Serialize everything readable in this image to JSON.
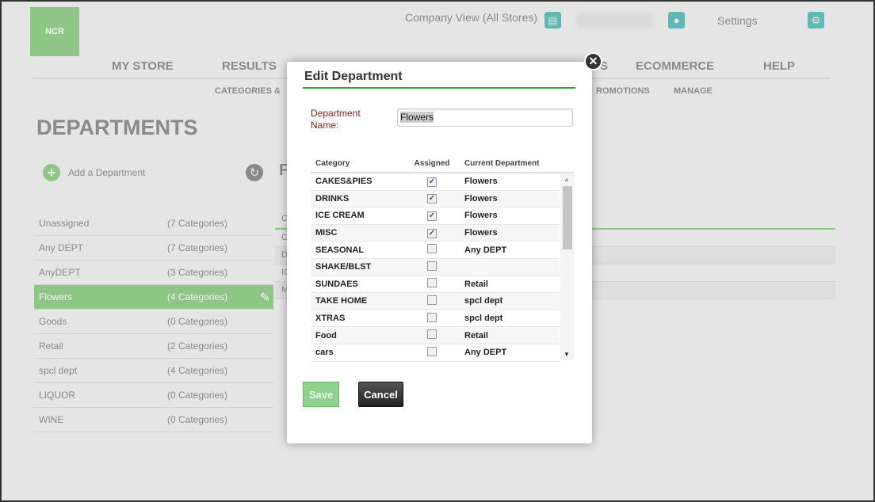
{
  "header": {
    "logo": "NCR",
    "company_view": "Company View (All Stores)",
    "user_name": "",
    "settings": "Settings"
  },
  "nav": {
    "items": [
      "MY STORE",
      "RESULTS",
      "S",
      "ECOMMERCE",
      "HELP"
    ],
    "sub": [
      "CATEGORIES &",
      "ROMOTIONS",
      "MANAGE"
    ]
  },
  "page": {
    "title": "DEPARTMENTS",
    "add_label": "Add a Department",
    "detail_title": "F"
  },
  "departments": [
    {
      "name": "Unassigned",
      "count": "(7 Categories)"
    },
    {
      "name": "Any DEPT",
      "count": "(7 Categories)"
    },
    {
      "name": "AnyDEPT",
      "count": "(3 Categories)"
    },
    {
      "name": "Flowers",
      "count": "(4 Categories)"
    },
    {
      "name": "Goods",
      "count": "(0 Categories)"
    },
    {
      "name": "Retail",
      "count": "(2 Categories)"
    },
    {
      "name": "spcl dept",
      "count": "(4 Categories)"
    },
    {
      "name": "LIQUOR",
      "count": "(0 Categories)"
    },
    {
      "name": "WINE",
      "count": "(0 Categories)"
    }
  ],
  "background_table": {
    "header": "C",
    "rows": [
      "C",
      "D",
      "IC",
      "M"
    ]
  },
  "modal": {
    "title": "Edit Department",
    "name_label": "Department Name:",
    "name_value": "Flowers",
    "columns": [
      "Category",
      "Assigned",
      "Current Department"
    ],
    "rows": [
      {
        "category": "CAKES&PIES",
        "assigned": true,
        "dept": "Flowers"
      },
      {
        "category": "DRINKS",
        "assigned": true,
        "dept": "Flowers"
      },
      {
        "category": "ICE CREAM",
        "assigned": true,
        "dept": "Flowers"
      },
      {
        "category": "MISC",
        "assigned": true,
        "dept": "Flowers"
      },
      {
        "category": "SEASONAL",
        "assigned": false,
        "dept": "Any DEPT"
      },
      {
        "category": "SHAKE/BLST",
        "assigned": false,
        "dept": ""
      },
      {
        "category": "SUNDAES",
        "assigned": false,
        "dept": "Retail"
      },
      {
        "category": "TAKE HOME",
        "assigned": false,
        "dept": "spcl dept"
      },
      {
        "category": "XTRAS",
        "assigned": false,
        "dept": "spcl dept"
      },
      {
        "category": "Food",
        "assigned": false,
        "dept": "Retail"
      },
      {
        "category": "cars",
        "assigned": false,
        "dept": "Any DEPT"
      }
    ],
    "save": "Save",
    "cancel": "Cancel"
  },
  "colors": {
    "accent": "#8fc587",
    "teal": "#5fb8b4",
    "modal_rule": "#2aa52a"
  }
}
